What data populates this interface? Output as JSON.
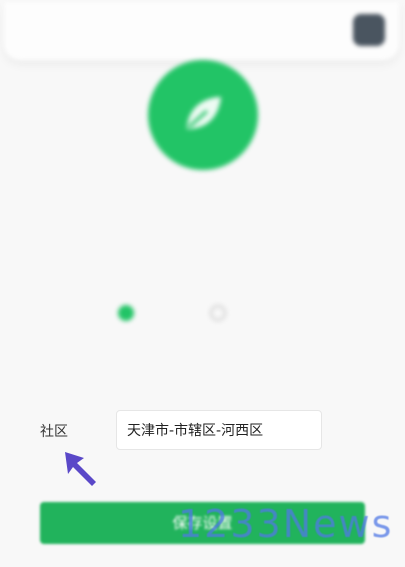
{
  "header": {
    "title": "",
    "subtitle": ""
  },
  "logo": {
    "icon": "leaf-bird-icon",
    "color": "#22c466",
    "subtitle": ""
  },
  "form": {
    "rows": [
      {
        "label": "",
        "value": ""
      },
      {
        "label": "",
        "value": ""
      },
      {
        "label": "",
        "value": ""
      }
    ],
    "community": {
      "label": "社区",
      "value": "天津市-市辖区-河西区"
    },
    "save_button": "保存设置"
  },
  "cursor": {
    "icon": "arrow-pointer-icon",
    "color": "#5a48c8"
  },
  "watermark": {
    "text": "1233News"
  },
  "colors": {
    "accent": "#21b35c",
    "background": "#f8f8f8"
  }
}
